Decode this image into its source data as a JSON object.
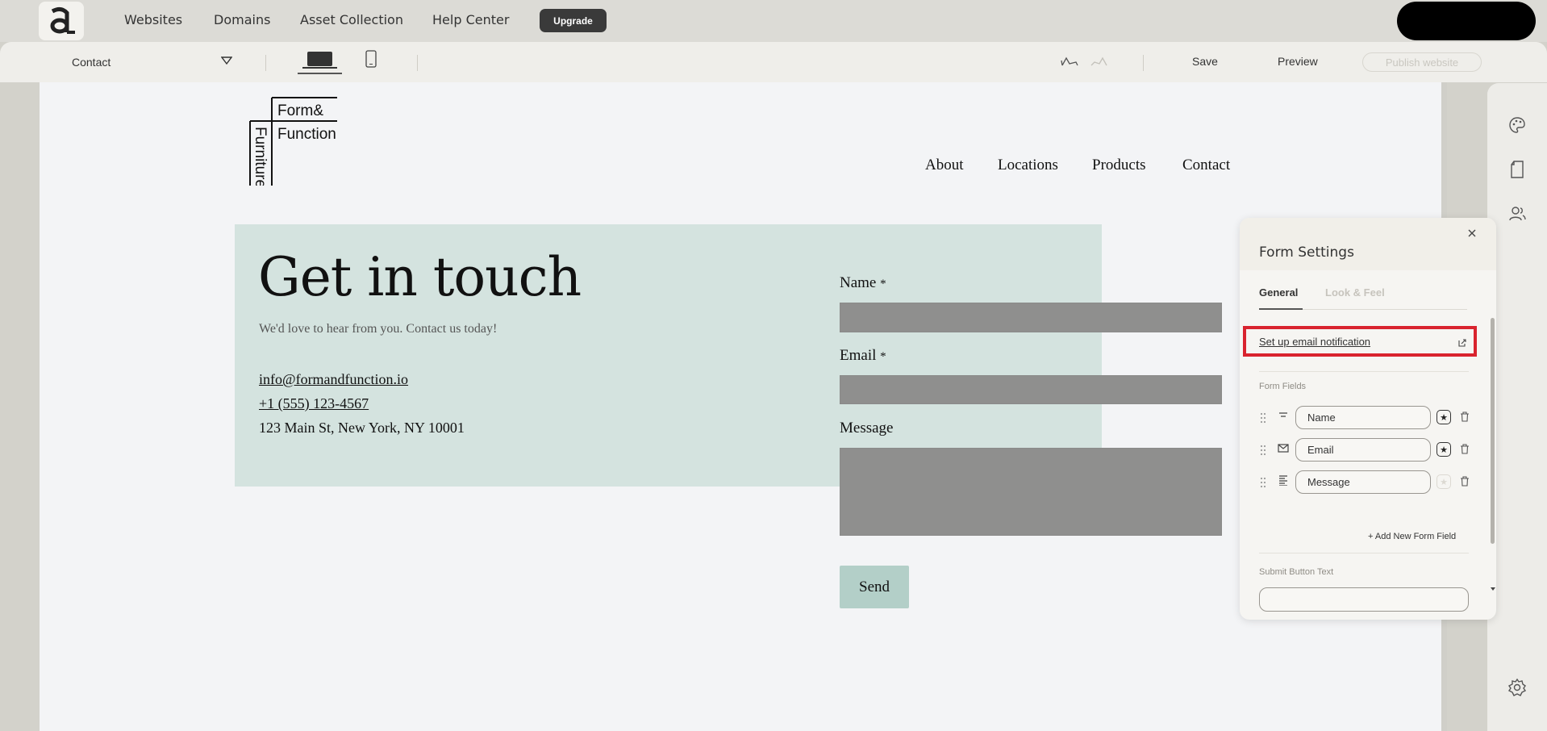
{
  "app": {
    "nav": [
      "Websites",
      "Domains",
      "Asset Collection",
      "Help Center"
    ],
    "upgrade_label": "Upgrade"
  },
  "toolbar": {
    "page_selected": "Contact",
    "save_label": "Save",
    "preview_label": "Preview",
    "publish_label": "Publish website"
  },
  "site": {
    "logo_text": [
      "Form&",
      "Function",
      "Furniture"
    ],
    "nav": [
      "About",
      "Locations",
      "Products",
      "Contact"
    ],
    "hero_title": "Get in touch",
    "hero_subtitle": "We'd love to hear from you. Contact us today!",
    "email": "info@formandfunction.io",
    "phone": "+1 (555) 123-4567",
    "address": "123 Main St, New York, NY 10001",
    "form": {
      "name_label": "Name",
      "email_label": "Email",
      "message_label": "Message",
      "required_mark": "*",
      "send_label": "Send"
    }
  },
  "panel": {
    "title": "Form Settings",
    "tabs": [
      "General",
      "Look & Feel"
    ],
    "email_notification_label": "Set up email notification",
    "form_fields_label": "Form Fields",
    "fields": [
      {
        "label": "Name",
        "required": true
      },
      {
        "label": "Email",
        "required": true
      },
      {
        "label": "Message",
        "required": false
      }
    ],
    "add_field_label": "+ Add New Form Field",
    "submit_label": "Submit Button Text"
  },
  "colors": {
    "highlight": "#d9232e",
    "hero_bg": "#d4e3df",
    "send_button": "#b3cfc8",
    "field_fill": "#8f8f8e"
  },
  "icons": [
    "app-logo-icon",
    "dropdown-caret-icon",
    "desktop-icon",
    "mobile-icon",
    "undo-icon",
    "redo-icon",
    "palette-icon",
    "page-icon",
    "users-icon",
    "settings-gear-icon",
    "close-icon",
    "external-link-icon",
    "drag-handle-icon",
    "short-text-icon",
    "mail-icon",
    "paragraph-icon",
    "required-star-icon",
    "trash-icon",
    "scroll-down-icon"
  ]
}
